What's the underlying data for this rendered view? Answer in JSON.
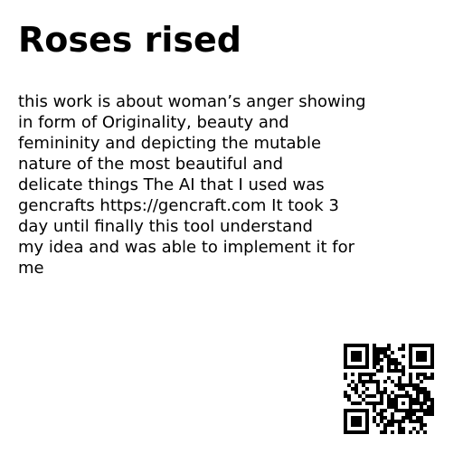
{
  "title": "Roses rised",
  "description_lines": [
    "this work is about woman’s anger showing",
    "in form of Originality, beauty and",
    "femininity and depicting the mutable",
    "nature of the most beautiful and",
    "delicate things The AI that I used was",
    "gencrafts https://gencraft.com It took 3",
    "day until finally this tool understand",
    "my idea and was able to implement it for",
    "me"
  ],
  "qr_code": {
    "icon": "qr-code-icon",
    "color": "#000000"
  }
}
